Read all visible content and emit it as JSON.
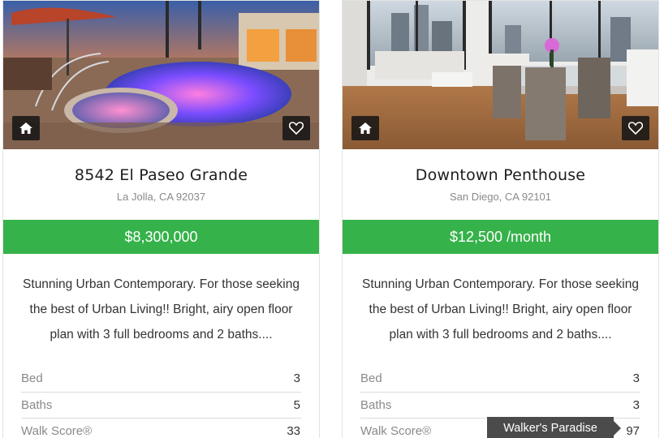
{
  "listings": [
    {
      "title": "8542 El Paseo Grande",
      "address": "La Jolla, CA 92037",
      "price": "$8,300,000",
      "description": "Stunning Urban Contemporary. For those seeking the best of Urban Living!! Bright, airy open floor plan with 3 full bedrooms and 2 baths....",
      "stats": [
        {
          "label": "Bed",
          "value": "3"
        },
        {
          "label": "Baths",
          "value": "5"
        },
        {
          "label": "Walk Score®",
          "value": "33"
        }
      ]
    },
    {
      "title": "Downtown Penthouse",
      "address": "San Diego, CA 92101",
      "price": "$12,500 /month",
      "description": "Stunning Urban Contemporary. For those seeking the best of Urban Living!! Bright, airy open floor plan with 3 full bedrooms and 2 baths....",
      "stats": [
        {
          "label": "Bed",
          "value": "3"
        },
        {
          "label": "Baths",
          "value": "3"
        },
        {
          "label": "Walk Score®",
          "value": "97"
        }
      ],
      "walk_score_tooltip": "Walker's Paradise"
    }
  ],
  "icons": {
    "property_type": "home-icon",
    "favorite": "heart-outline-icon"
  },
  "colors": {
    "price_bar": "#36b24a",
    "badge_bg": "#141414",
    "tooltip_bg": "#4b4b4b"
  }
}
